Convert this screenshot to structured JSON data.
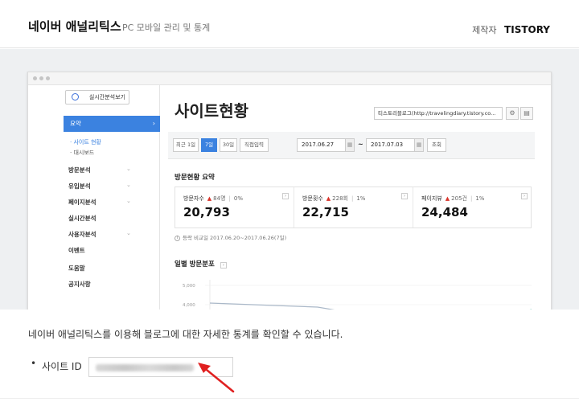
{
  "header": {
    "brand": "네이버 애널리틱스",
    "subtitle": "PC 모바일 관리 및 통계",
    "maker_label": "제작자",
    "maker_name": "TISTORY"
  },
  "preview": {
    "sidebar": {
      "realtime_button": "실시간분석보기",
      "active_menu": "요약",
      "sub_items": [
        "· 사이트 현황",
        "· 대시보드"
      ],
      "menu_items": [
        "방문분석",
        "유입분석",
        "페이지분석",
        "실시간분석",
        "사용자분석",
        "이벤트",
        "도움말",
        "공지사항"
      ]
    },
    "main": {
      "title": "사이트현황",
      "blog_select": "티스토리블로그(http://travelingdiary.tistory.co...",
      "period_buttons": [
        "최근 1일",
        "7일",
        "30일",
        "직접입력"
      ],
      "active_period": "7일",
      "date_from": "2017.06.27",
      "date_to": "2017.07.03",
      "date_sep": "~",
      "search_button": "조회",
      "summary_title": "방문현황 요약",
      "stats": [
        {
          "label": "방문자수",
          "change": "84명",
          "percent": "0%",
          "value": "20,793"
        },
        {
          "label": "방문횟수",
          "change": "228회",
          "percent": "1%",
          "value": "22,715"
        },
        {
          "label": "페이지뷰",
          "change": "205건",
          "percent": "1%",
          "value": "24,484"
        }
      ],
      "compare_text": "등락 비교일  2017.06.20~2017.06.26(7일)",
      "daily_title": "일별 방문분포",
      "chart_ticks": [
        "5,000",
        "4,000"
      ]
    }
  },
  "bottom": {
    "description": "네이버 애널리틱스를 이용해 블로그에 대한 자세한 통계를 확인할 수 있습니다.",
    "site_id_label": "사이트 ID",
    "bullet": "•",
    "arrow_color": "#e02020"
  },
  "colors": {
    "accent": "#3b82e0",
    "up_arrow": "#d9342b"
  }
}
